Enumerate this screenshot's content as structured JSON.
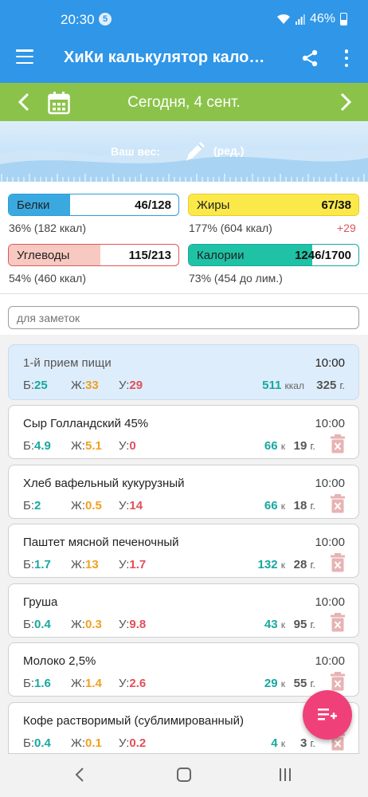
{
  "status": {
    "time": "20:30",
    "notif_count": "5",
    "battery": "46%"
  },
  "appbar": {
    "title": "ХиКи калькулятор кало…"
  },
  "datebar": {
    "date": "Сегодня, 4 сент."
  },
  "weight": {
    "label": "Ваш вес:",
    "edit": "(ред.)"
  },
  "macros": {
    "protein": {
      "name": "Белки",
      "value": "46/128",
      "sub": "36% (182 ккал)",
      "fraction": 0.36,
      "color": "#2b9fd6",
      "fill": "#3aa9e0"
    },
    "fat": {
      "name": "Жиры",
      "value": "67/38",
      "sub": "177% (604 ккал)",
      "over": "+29",
      "fraction": 1.0,
      "color": "#e9c92a",
      "fill": "#fbe94a"
    },
    "carbs": {
      "name": "Углеводы",
      "value": "115/213",
      "sub": "54% (460 ккал)",
      "fraction": 0.54,
      "color": "#e0565b",
      "fill": "#f8c9c0"
    },
    "calories": {
      "name": "Калории",
      "value": "1246/1700",
      "sub": "73% (454 до лим.)",
      "fraction": 0.73,
      "color": "#17a8a0",
      "fill": "#1fc2a5"
    }
  },
  "notes": {
    "placeholder": "для заметок"
  },
  "meal": {
    "name": "1-й прием пищи",
    "time": "10:00",
    "b": "25",
    "z": "33",
    "u": "29",
    "kcal": "511",
    "kcal_unit": "ккал",
    "grams": "325",
    "g_unit": "г."
  },
  "labels": {
    "b": "Б:",
    "z": "Ж:",
    "u": "У:",
    "k": "к",
    "g": "г."
  },
  "items": [
    {
      "name": "Сыр Голландский 45%",
      "time": "10:00",
      "b": "4.9",
      "z": "5.1",
      "u": "0",
      "kcal": "66",
      "grams": "19"
    },
    {
      "name": "Хлеб вафельный кукурузный",
      "time": "10:00",
      "b": "2",
      "z": "0.5",
      "u": "14",
      "kcal": "66",
      "grams": "18"
    },
    {
      "name": "Паштет мясной печеночный",
      "time": "10:00",
      "b": "1.7",
      "z": "13",
      "u": "1.7",
      "kcal": "132",
      "grams": "28"
    },
    {
      "name": "Груша",
      "time": "10:00",
      "b": "0.4",
      "z": "0.3",
      "u": "9.8",
      "kcal": "43",
      "grams": "95"
    },
    {
      "name": "Молоко 2,5%",
      "time": "10:00",
      "b": "1.6",
      "z": "1.4",
      "u": "2.6",
      "kcal": "29",
      "grams": "55"
    },
    {
      "name": "Кофе растворимый (сублимированный)",
      "time": "",
      "b": "0.4",
      "z": "0.1",
      "u": "0.2",
      "kcal": "4",
      "grams": "3"
    }
  ]
}
